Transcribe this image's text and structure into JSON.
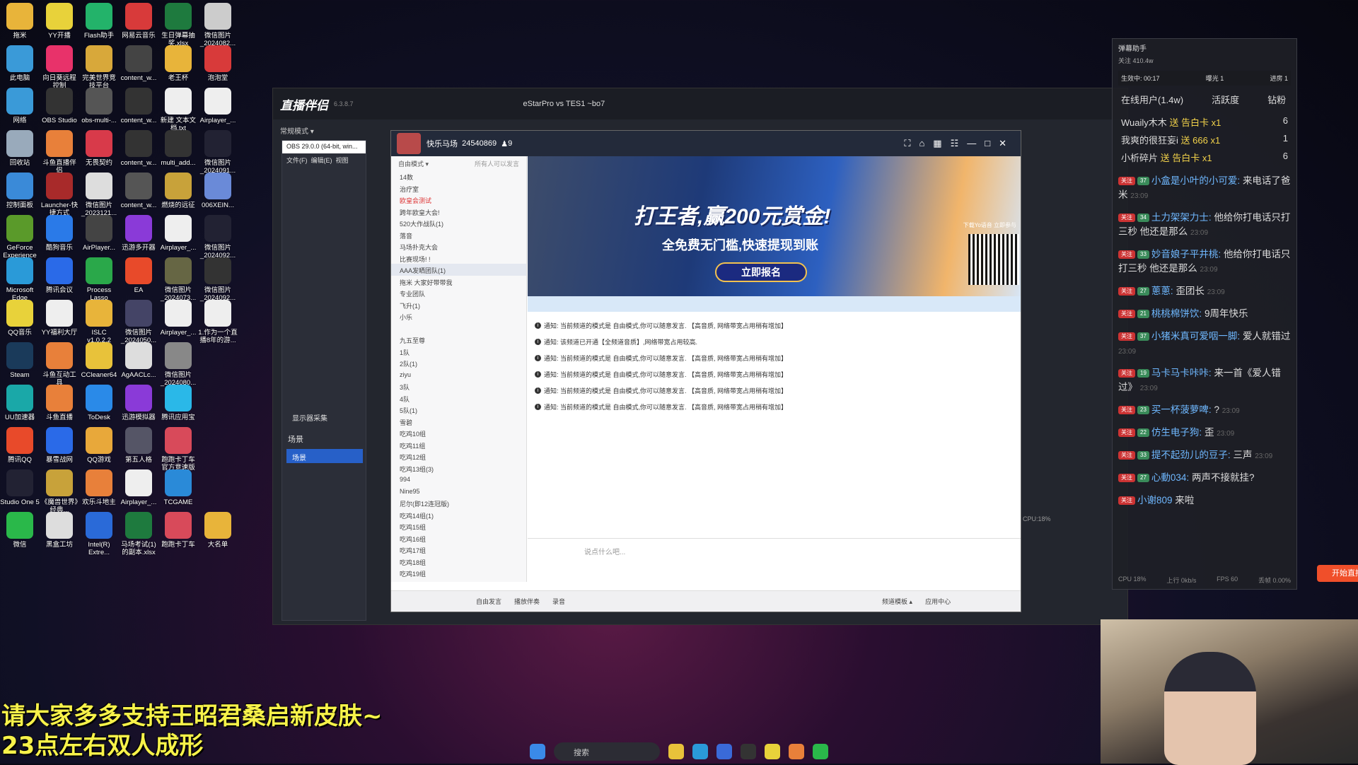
{
  "desktop": [
    {
      "label": "拖米",
      "color": "#e8b43a",
      "col": 0,
      "row": 0
    },
    {
      "label": "YY开播",
      "color": "#e8d23a",
      "col": 1,
      "row": 0
    },
    {
      "label": "Flash助手",
      "color": "#23b36a",
      "col": 2,
      "row": 0
    },
    {
      "label": "网易云音乐",
      "color": "#d83a3a",
      "col": 3,
      "row": 0
    },
    {
      "label": "生日弹幕抽奖.xlsx",
      "color": "#1e7a3e",
      "col": 4,
      "row": 0
    },
    {
      "label": "微信图片_2024082...",
      "color": "#ccc",
      "col": 5,
      "row": 0
    },
    {
      "label": "此电脑",
      "color": "#3a9ad8",
      "col": 0,
      "row": 1
    },
    {
      "label": "向日葵远程控制",
      "color": "#e8326a",
      "col": 1,
      "row": 1
    },
    {
      "label": "完美世界竞技平台",
      "color": "#d8a83a",
      "col": 2,
      "row": 1
    },
    {
      "label": "content_w...",
      "color": "#444",
      "col": 3,
      "row": 1
    },
    {
      "label": "老王杯",
      "color": "#e8b43a",
      "col": 4,
      "row": 1
    },
    {
      "label": "泡泡堂",
      "color": "#d83a3a",
      "col": 5,
      "row": 1
    },
    {
      "label": "网络",
      "color": "#3a9ad8",
      "col": 0,
      "row": 2
    },
    {
      "label": "OBS Studio",
      "color": "#333",
      "col": 1,
      "row": 2
    },
    {
      "label": "obs-multi-...",
      "color": "#555",
      "col": 2,
      "row": 2
    },
    {
      "label": "content_w...",
      "color": "#333",
      "col": 3,
      "row": 2
    },
    {
      "label": "新建 文本文档.txt",
      "color": "#eee",
      "col": 4,
      "row": 2
    },
    {
      "label": "Airplayer_...",
      "color": "#eee",
      "col": 5,
      "row": 2
    },
    {
      "label": "回收站",
      "color": "#9ab",
      "col": 0,
      "row": 3
    },
    {
      "label": "斗鱼直播伴侣",
      "color": "#e8803a",
      "col": 1,
      "row": 3
    },
    {
      "label": "无畏契约",
      "color": "#d83a4a",
      "col": 2,
      "row": 3
    },
    {
      "label": "content_w...",
      "color": "#333",
      "col": 3,
      "row": 3
    },
    {
      "label": "multi_add...",
      "color": "#333",
      "col": 4,
      "row": 3
    },
    {
      "label": "微信图片_2024091...",
      "color": "#223",
      "col": 5,
      "row": 3
    },
    {
      "label": "控制面板",
      "color": "#3a8ad8",
      "col": 0,
      "row": 4
    },
    {
      "label": "Launcher-快捷方式",
      "color": "#a82a2a",
      "col": 1,
      "row": 4
    },
    {
      "label": "微信图片_2023121...",
      "color": "#ddd",
      "col": 2,
      "row": 4
    },
    {
      "label": "content_w...",
      "color": "#555",
      "col": 3,
      "row": 4
    },
    {
      "label": "燃烧的远征",
      "color": "#c8a23a",
      "col": 4,
      "row": 4
    },
    {
      "label": "006XEIN...",
      "color": "#6a8ad8",
      "col": 5,
      "row": 4
    },
    {
      "label": "GeForce Experience",
      "color": "#5a9a2a",
      "col": 0,
      "row": 5
    },
    {
      "label": "酷狗音乐",
      "color": "#2a7ae8",
      "col": 1,
      "row": 5
    },
    {
      "label": "AirPlayer...",
      "color": "#444",
      "col": 2,
      "row": 5
    },
    {
      "label": "迅游多开器",
      "color": "#8a3ad8",
      "col": 3,
      "row": 5
    },
    {
      "label": "Airplayer_...",
      "color": "#eee",
      "col": 4,
      "row": 5
    },
    {
      "label": "微信图片_2024092...",
      "color": "#223",
      "col": 5,
      "row": 5
    },
    {
      "label": "Microsoft Edge",
      "color": "#2a9ad8",
      "col": 0,
      "row": 6
    },
    {
      "label": "腾讯会议",
      "color": "#2a6ae8",
      "col": 1,
      "row": 6
    },
    {
      "label": "Process Lasso",
      "color": "#2aa84a",
      "col": 2,
      "row": 6
    },
    {
      "label": "EA",
      "color": "#e84a2a",
      "col": 3,
      "row": 6
    },
    {
      "label": "微信图片_2024073...",
      "color": "#664",
      "col": 4,
      "row": 6
    },
    {
      "label": "微信图片_2024092...",
      "color": "#333",
      "col": 5,
      "row": 6
    },
    {
      "label": "QQ音乐",
      "color": "#e8d23a",
      "col": 0,
      "row": 7
    },
    {
      "label": "YY福利大厅",
      "color": "#eee",
      "col": 1,
      "row": 7
    },
    {
      "label": "ISLC v1.0.2.2",
      "color": "#e8b43a",
      "col": 2,
      "row": 7
    },
    {
      "label": "微信图片_2024050...",
      "color": "#446",
      "col": 3,
      "row": 7
    },
    {
      "label": "Airplayer_...",
      "color": "#eee",
      "col": 4,
      "row": 7
    },
    {
      "label": "1.作为一个直播8年的游...",
      "color": "#eee",
      "col": 5,
      "row": 7
    },
    {
      "label": "Steam",
      "color": "#1a3a5a",
      "col": 0,
      "row": 8
    },
    {
      "label": "斗鱼互动工具",
      "color": "#e8803a",
      "col": 1,
      "row": 8
    },
    {
      "label": "CCleaner64",
      "color": "#e8c23a",
      "col": 2,
      "row": 8
    },
    {
      "label": "AgAACLc...",
      "color": "#ddd",
      "col": 3,
      "row": 8
    },
    {
      "label": "微信图片_2024080...",
      "color": "#888",
      "col": 4,
      "row": 8
    },
    {
      "label": "UU加速器",
      "color": "#1aa8a8",
      "col": 0,
      "row": 9
    },
    {
      "label": "斗鱼直播",
      "color": "#e8803a",
      "col": 1,
      "row": 9
    },
    {
      "label": "ToDesk",
      "color": "#2a8ae8",
      "col": 2,
      "row": 9
    },
    {
      "label": "迅游模拟器",
      "color": "#8a3ad8",
      "col": 3,
      "row": 9
    },
    {
      "label": "腾讯应用宝",
      "color": "#2ab8e8",
      "col": 4,
      "row": 9
    },
    {
      "label": "腾讯QQ",
      "color": "#e84a2a",
      "col": 0,
      "row": 10
    },
    {
      "label": "暴雪战网",
      "color": "#2a6ae8",
      "col": 1,
      "row": 10
    },
    {
      "label": "QQ游戏",
      "color": "#e8a83a",
      "col": 2,
      "row": 10
    },
    {
      "label": "第五人格",
      "color": "#556",
      "col": 3,
      "row": 10
    },
    {
      "label": "跑跑卡丁车官方竞速版",
      "color": "#d84a5a",
      "col": 4,
      "row": 10
    },
    {
      "label": "Studio One 5",
      "color": "#223",
      "col": 0,
      "row": 11
    },
    {
      "label": "《魔兽世界》经典...",
      "color": "#c8a23a",
      "col": 1,
      "row": 11
    },
    {
      "label": "欢乐斗地主",
      "color": "#e8803a",
      "col": 2,
      "row": 11
    },
    {
      "label": "Airplayer_...",
      "color": "#eee",
      "col": 3,
      "row": 11
    },
    {
      "label": "TCGAME",
      "color": "#2a8ad8",
      "col": 4,
      "row": 11
    },
    {
      "label": "微信",
      "color": "#2ab84a",
      "col": 0,
      "row": 12
    },
    {
      "label": "黑盒工坊",
      "color": "#ddd",
      "col": 1,
      "row": 12
    },
    {
      "label": "Intel(R) Extre...",
      "color": "#2a6ad8",
      "col": 2,
      "row": 12
    },
    {
      "label": "马场考试(1)的副本.xlsx",
      "color": "#1e7a3e",
      "col": 3,
      "row": 12
    },
    {
      "label": "跑跑卡丁车",
      "color": "#d84a5a",
      "col": 4,
      "row": 12
    },
    {
      "label": "大名单",
      "color": "#e8b43a",
      "col": 5,
      "row": 12
    }
  ],
  "assistant": {
    "title": "直播伴侣",
    "version": "6.3.8.7",
    "mode": "常规模式 ▾",
    "scene_tab": "eStarPro vs TES1 ~bo7",
    "start_button": "开始直播",
    "cpu": "CPU:18%"
  },
  "obs": {
    "title": "OBS 29.0.0 (64-bit, win...",
    "menu": [
      "文件(F)",
      "编辑(E)",
      "视图"
    ],
    "scenes_label": "场景",
    "scene_item": "场景",
    "display": "显示器采集"
  },
  "yy": {
    "channel": "快乐马场",
    "channel_id": "24540869",
    "online": "9",
    "mode": "自由模式 ▾",
    "perm": "所有人可以发言",
    "tree": [
      "14数",
      "治疗室",
      "欧皇会测试",
      "跨年欧皇大会!",
      "520大作战队(1)",
      "  落音",
      "马场扑克大会",
      "比赛现场! !",
      "AAA发晒团队(1)",
      "  拖米   大家好带带我",
      "专业团队",
      "飞升(1)",
      "  小乐",
      "",
      "九五至尊",
      "1队",
      "2队(1)",
      "  ziyu",
      "3队",
      "4队",
      "5队(1)",
      "  雪碧",
      "吃鸡10组",
      "吃鸡11组",
      "吃鸡12组",
      "吃鸡13组(3)",
      "  994",
      "  Nine95",
      "  尼尔(即12连冠版)",
      "吃鸡14组(1)",
      "吃鸡15组",
      "吃鸡16组",
      "吃鸡17组",
      "吃鸡18组",
      "吃鸡19组"
    ],
    "banner_title": "打王者,赢200元赏金!",
    "banner_sub": "全免费无门槛,快速提现到账",
    "banner_btn": "立即报名",
    "banner_tag": "下载Yo语音 立即参与",
    "notices": [
      "通知: 当前频道的模式是 自由模式,你可以随意发言. 【高音质, 网络带宽占用稍有增加】",
      "通知: 该频道已开通【全频道音质】,网络带宽占用较高.",
      "通知: 当前频道的模式是 自由模式,你可以随意发言. 【高音质, 网络带宽占用稍有增加】",
      "通知: 当前频道的模式是 自由模式,你可以随意发言. 【高音质, 网络带宽占用稍有增加】",
      "通知: 当前频道的模式是 自由模式,你可以随意发言. 【高音质, 网络带宽占用稍有增加】",
      "通知: 当前频道的模式是 自由模式,你可以随意发言. 【高音质, 网络带宽占用稍有增加】"
    ],
    "input_placeholder": "说点什么吧...",
    "bottom": [
      "自由发言",
      "播放伴奏",
      "录音",
      "频道模板 ▴",
      "应用中心"
    ]
  },
  "danmu": {
    "title": "弹幕助手",
    "fans": "关注 410.4w",
    "live_time": "生效中: 00:17",
    "exposure": "曝光 1",
    "enter": "进房 1",
    "tabs": [
      "在线用户(1.4w)",
      "活跃度",
      "钻粉"
    ],
    "gifts": [
      {
        "user": "Wuaily木木",
        "text": "送 告白卡",
        "count": "x1",
        "num": "6"
      },
      {
        "user": "我爽的很狂妄i",
        "text": "送 666",
        "count": "x1",
        "num": "1"
      },
      {
        "user": "小析碎片",
        "text": "送 告白卡",
        "count": "x1",
        "num": "6"
      }
    ],
    "comments": [
      {
        "lv": "37",
        "user": "小盒是小叶的小可爱:",
        "text": "来电话了爸米",
        "time": "23:09"
      },
      {
        "lv": "34",
        "user": "土力架架力士:",
        "text": "他给你打电话只打三秒 他还是那么",
        "time": "23:09"
      },
      {
        "lv": "33",
        "user": "妙音娘子平井桃:",
        "text": "他给你打电话只打三秒 他还是那么",
        "time": "23:09"
      },
      {
        "lv": "27",
        "user": "蔥蔥:",
        "text": "歪团长",
        "time": "23:09"
      },
      {
        "lv": "21",
        "user": "桃桃棉饼饮:",
        "text": "9周年快乐",
        "time": ""
      },
      {
        "lv": "37",
        "user": "小猪米真可爱咽一脚:",
        "text": "爱人就错过",
        "time": "23:09"
      },
      {
        "lv": "19",
        "user": "马卡马卡咔咔:",
        "text": "来一首《爱人错过》",
        "time": "23:09"
      },
      {
        "lv": "23",
        "user": "买一杯菠萝啤:",
        "text": "?",
        "time": "23:09"
      },
      {
        "lv": "22",
        "user": "仿生电子狗:",
        "text": "歪",
        "time": "23:09"
      },
      {
        "lv": "33",
        "user": "提不起劲儿的豆子:",
        "text": "三声",
        "time": "23:09"
      },
      {
        "lv": "27",
        "user": "心動034:",
        "text": "两声不接就挂?",
        "time": ""
      },
      {
        "lv": "",
        "user": "小谢809",
        "text": "来啦",
        "time": ""
      }
    ],
    "footer": [
      "CPU 18%",
      "上行 0kb/s",
      "FPS 60",
      "丢帧 0.00%"
    ]
  },
  "subtitle": [
    "请大家多多支持王昭君桑启新皮肤~",
    "23点左右双人成形"
  ],
  "taskbar": {
    "search": "搜索"
  }
}
